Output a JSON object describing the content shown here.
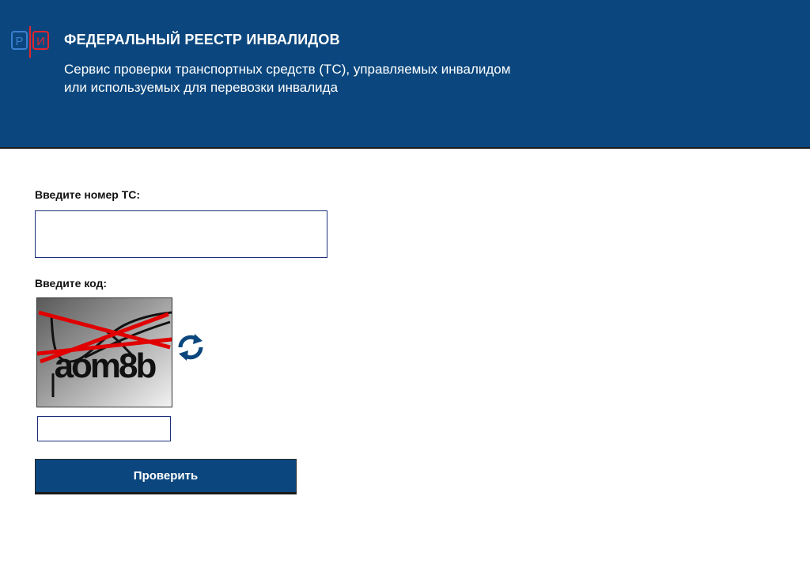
{
  "header": {
    "logo_icon": "ri-logo-icon",
    "logo_letters": [
      "Р",
      "И"
    ],
    "title": "ФЕДЕРАЛЬНЫЙ РЕЕСТР ИНВАЛИДОВ",
    "subtitle_line1": "Сервис проверки транспортных средств (ТС), управляемых инвалидом",
    "subtitle_line2": "или используемых для перевозки инвалида",
    "background_color": "#0b477e"
  },
  "form": {
    "plate_label": "Введите номер ТС:",
    "plate_value": "",
    "code_label": "Введите код:",
    "captcha_text": "aom8b",
    "refresh_icon": "refresh-icon",
    "code_value": "",
    "submit_label": "Проверить"
  },
  "colors": {
    "accent": "#0b477e",
    "logo_blue": "#3b7fd0",
    "logo_red": "#e2262c",
    "captcha_lines": "#e00000"
  }
}
